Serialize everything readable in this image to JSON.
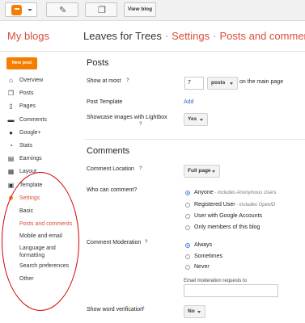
{
  "topbar": {
    "view_blog_label": "View blog",
    "icons": [
      "blogger-logo-icon",
      "pencil-icon",
      "pages-icon"
    ]
  },
  "header": {
    "my_blogs": "My blogs",
    "blog_name": "Leaves for Trees",
    "separator": "·",
    "crumb_settings": "Settings",
    "crumb_current": "Posts and comments"
  },
  "sidebar": {
    "new_post_label": "New post",
    "items": [
      {
        "label": "Overview",
        "icon": "home-icon"
      },
      {
        "label": "Posts",
        "icon": "posts-icon"
      },
      {
        "label": "Pages",
        "icon": "pages-icon"
      },
      {
        "label": "Comments",
        "icon": "comments-icon"
      },
      {
        "label": "Google+",
        "icon": "google-plus-icon"
      },
      {
        "label": "Stats",
        "icon": "stats-icon"
      },
      {
        "label": "Earnings",
        "icon": "earnings-icon"
      },
      {
        "label": "Layout",
        "icon": "layout-icon"
      },
      {
        "label": "Template",
        "icon": "template-icon"
      },
      {
        "label": "Settings",
        "icon": "wrench-icon"
      }
    ],
    "settings_subitems": [
      "Basic",
      "Posts and comments",
      "Mobile and email",
      "Language and",
      "formatting",
      "Search preferences",
      "Other"
    ]
  },
  "posts": {
    "title": "Posts",
    "show_at_most_label": "Show at most",
    "show_at_most_value": "7",
    "unit_select": "posts",
    "unit_suffix": "on the main page",
    "post_template_label": "Post Template",
    "post_template_link": "Add",
    "lightbox_label_1": "Showcase images with Lightbox",
    "lightbox_value": "Yes"
  },
  "comments": {
    "title": "Comments",
    "location_label": "Comment Location",
    "location_value": "Full page",
    "who_label": "Who can comment?",
    "who_options": [
      {
        "label": "Anyone",
        "note": " - includes Anonymous Users",
        "checked": true
      },
      {
        "label": "Registered User",
        "note": " - includes OpenID",
        "checked": false
      },
      {
        "label": "User with Google Accounts",
        "note": "",
        "checked": false
      },
      {
        "label": "Only members of this blog",
        "note": "",
        "checked": false
      }
    ],
    "moderation_label": "Comment Moderation",
    "moderation_options": [
      {
        "label": "Always",
        "checked": true
      },
      {
        "label": "Sometimes",
        "checked": false
      },
      {
        "label": "Never",
        "checked": false
      }
    ],
    "email_moderation_label": "Email moderation requests to",
    "email_moderation_value": "",
    "word_verification_label": "Show word verification",
    "word_verification_value": "No"
  },
  "help_mark": "?",
  "colors": {
    "accent": "#dd4b39",
    "brand": "#f57d00",
    "link": "#3366cc",
    "annotation": "#d40000"
  }
}
